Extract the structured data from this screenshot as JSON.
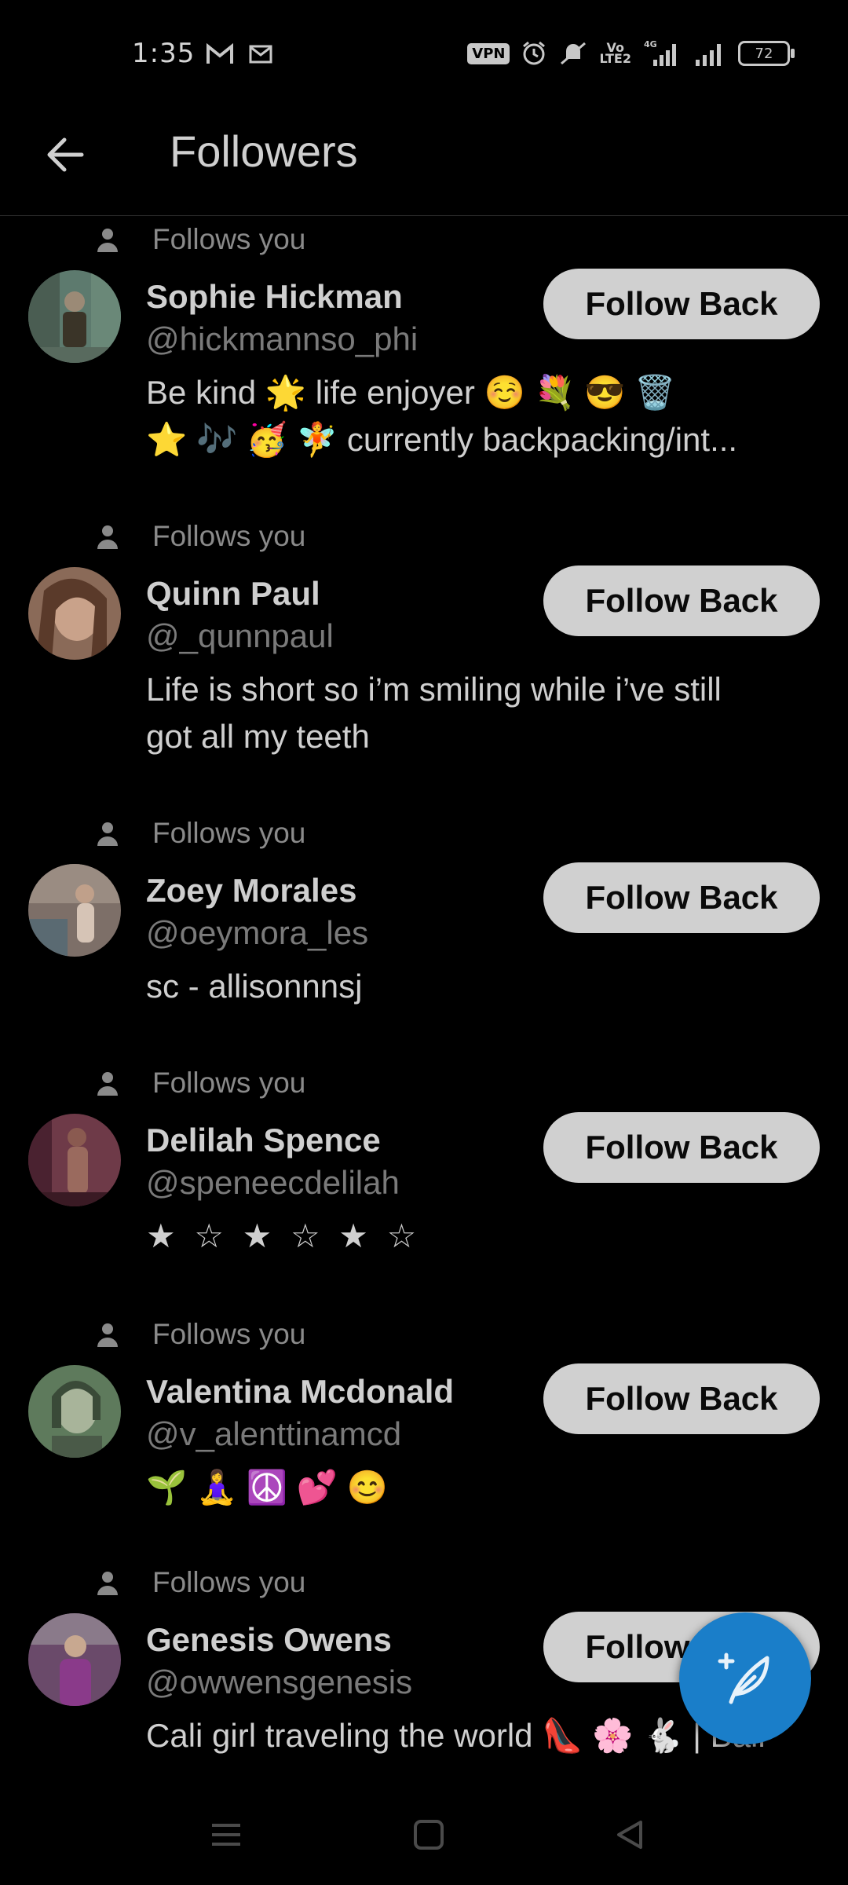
{
  "status_bar": {
    "time": "1:35",
    "vpn": "VPN",
    "volte": "Vo\nLTE2",
    "network": "4G",
    "battery": "72"
  },
  "header": {
    "title": "Followers"
  },
  "followers": [
    {
      "follows_label": "Follows you",
      "name": "Sophie Hickman",
      "handle": "@hickmannso_phi",
      "bio": "Be kind 🌟 life enjoyer ☺️ 💐 😎 🗑️\n⭐ 🎶 🥳 🧚 currently backpacking/int...",
      "button": "Follow Back",
      "avatar_color": "#5d7a6e"
    },
    {
      "follows_label": "Follows you",
      "name": "Quinn Paul",
      "handle": "@_qunnpaul",
      "bio": "Life is short so i’m smiling while i’ve still\ngot all my teeth",
      "button": "Follow Back",
      "avatar_color": "#8a6a58"
    },
    {
      "follows_label": "Follows you",
      "name": "Zoey Morales",
      "handle": "@oeymora_les",
      "bio": "sc - allisonnnsj",
      "button": "Follow Back",
      "avatar_color": "#7d6f68"
    },
    {
      "follows_label": "Follows you",
      "name": "Delilah Spence",
      "handle": "@speneecdelilah",
      "bio": "★ ☆ ★ ☆ ★ ☆",
      "button": "Follow Back",
      "avatar_color": "#6e3a48"
    },
    {
      "follows_label": "Follows you",
      "name": "Valentina Mcdonald",
      "handle": "@v_alenttinamcd",
      "bio": "🌱 🧘‍♀️ ☮️ 💕 😊",
      "button": "Follow Back",
      "avatar_color": "#5e7a5c"
    },
    {
      "follows_label": "Follows you",
      "name": "Genesis Owens",
      "handle": "@owwensgenesis",
      "bio": "Cali girl traveling the world 👠 🌸 🐇 | Bali",
      "button": "Follow Back",
      "avatar_color": "#6a4a6a"
    }
  ],
  "fab": {
    "icon": "compose-feather-icon"
  },
  "nav": {
    "icons": [
      "menu-icon",
      "home-square-icon",
      "back-triangle-icon"
    ]
  }
}
